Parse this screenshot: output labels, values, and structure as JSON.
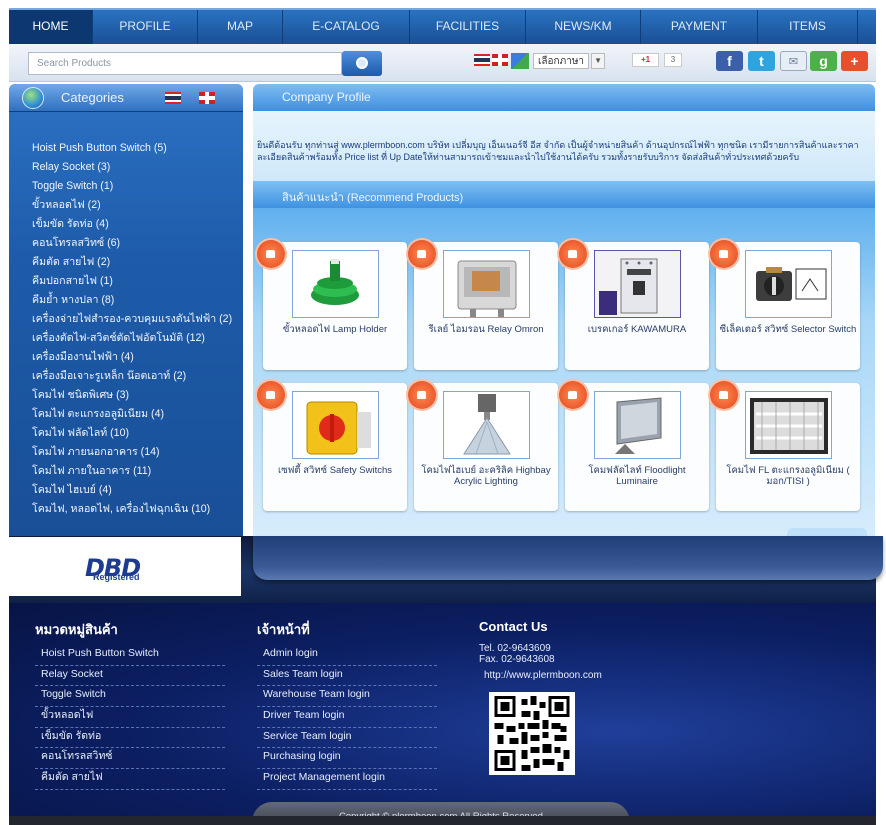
{
  "nav": {
    "items": [
      {
        "label": "HOME",
        "active": true
      },
      {
        "label": "PROFILE",
        "active": false
      },
      {
        "label": "MAP",
        "active": false
      },
      {
        "label": "E-CATALOG",
        "active": false
      },
      {
        "label": "FACILITIES",
        "active": false
      },
      {
        "label": "NEWS/KM",
        "active": false
      },
      {
        "label": "PAYMENT",
        "active": false
      },
      {
        "label": "ITEMS",
        "active": false
      }
    ]
  },
  "search": {
    "placeholder": "Search Products",
    "language_select": "เลือกภาษา",
    "gplus_label": "+1",
    "gplus_count": "3"
  },
  "sidebar": {
    "title": "Categories",
    "items": [
      "Hoist Push Button Switch (5)",
      "Relay Socket (3)",
      "Toggle Switch (1)",
      "ขั้วหลอดไฟ (2)",
      "เข็มขัด รัดท่อ (4)",
      "คอนโทรลสวิทซ์ (6)",
      "คีมตัด สายไฟ (2)",
      "คีมปอกสายไฟ (1)",
      "คีมย้ำ หางปลา (8)",
      "เครื่องจ่ายไฟสำรอง-ควบคุมแรงดันไฟฟ้า (2)",
      "เครื่องตัดไฟ-สวิตช์ตัดไฟอัตโนมัติ (12)",
      "เครื่องมืองานไฟฟ้า (4)",
      "เครื่องมือเจาะรูเหล็ก น๊อตเอาท์ (2)",
      "โคมไฟ ชนิดพิเศษ (3)",
      "โคมไฟ ตะแกรงอลูมิเนียม (4)",
      "โคมไฟ ฟลัดไลท์ (10)",
      "โคมไฟ ภายนอกอาคาร (14)",
      "โคมไฟ ภายในอาคาร (11)",
      "โคมไฟ ไฮเบย์ (4)",
      "โคมไฟ, หลอดไฟ, เครื่องไฟฉุกเฉิน (10)"
    ]
  },
  "profile": {
    "title": "Company Profile",
    "text": "ยินดีต้อนรับ ทุกท่านสู่ www.plermboon.com บริษัท เปลี่มบุญ เอ็นเนอร์จี อีส จำกัด เป็นผู้จำหน่ายสินค้า ด้านอุปกรณ์ไฟฟ้า ทุกชนิด เรามีรายการสินค้าและราคาละเอียดสินค้าพร้อมทั้ง Price list ที่ Up Dateให้ท่านสามารถเข้าชมและนำไปใช้งานได้ครับ รวมทั้งรายรับบริการ จัดส่งสินค้าทั่วประเทศด้วยครับ"
  },
  "recommend": {
    "title": "สินค้าแนะนำ (Recommend Products)",
    "products": [
      {
        "name": "ขั้วหลอดไฟ Lamp Holder",
        "icon": "lamp-holder-image"
      },
      {
        "name": "รีเลย์ ไอมรอน Relay Omron",
        "icon": "relay-image"
      },
      {
        "name": "เบรคเกอร์ KAWAMURA",
        "icon": "breaker-image"
      },
      {
        "name": "ซีเล็คเตอร์ สวิทซ์ Selector Switch",
        "icon": "selector-switch-image"
      },
      {
        "name": "เซฟตี้ สวิทซ์ Safety Switchs",
        "icon": "safety-switch-image"
      },
      {
        "name": "โคมไฟไฮเบย์ อะคริลิค Highbay Acrylic Lighting",
        "icon": "highbay-image"
      },
      {
        "name": "โคมฟลัดไลท์ Floodlight Luminaire",
        "icon": "floodlight-image"
      },
      {
        "name": "โคมไฟ FL ตะแกรงอลูมิเนียม ( มอก/TISI )",
        "icon": "fl-fixture-image"
      }
    ]
  },
  "dbd": {
    "logo_text": "DBD",
    "sub": "Registered"
  },
  "footer": {
    "categories_title": "หมวดหมู่สินค้า",
    "categories": [
      "Hoist Push Button Switch",
      "Relay Socket",
      "Toggle Switch",
      "ขั้วหลอดไฟ",
      "เข็มขัด รัดท่อ",
      "คอนโทรลสวิทซ์",
      "คีมตัด สายไฟ"
    ],
    "staff_title": "เจ้าหน้าที่",
    "staff": [
      "Admin login",
      "Sales Team login",
      "Warehouse Team login",
      "Driver Team login",
      "Service Team login",
      "Purchasing login",
      "Project Management login"
    ],
    "contact_title": "Contact Us",
    "tel": "Tel. 02-9643609",
    "fax": "Fax. 02-9643608",
    "url": "http://www.plermboon.com",
    "copyright": "Copyright © plermboon.com All Rights Reserved"
  },
  "colors": {
    "nav": "#1f5fa9",
    "sidebar": "#1d5ba9",
    "footer": "#0c1f63",
    "like_badge": "#e4451e"
  }
}
